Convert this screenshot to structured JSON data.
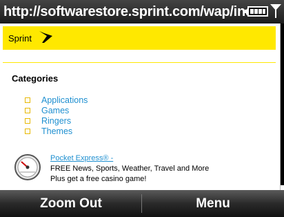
{
  "titlebar": {
    "url": "http://softwarestore.sprint.com/wap/ind",
    "battery_icon": "battery-icon",
    "signal_icon": "antenna-signal-icon"
  },
  "brand": {
    "name": "Sprint",
    "color": "#ffe800"
  },
  "categories": {
    "title": "Categories",
    "items": [
      {
        "label": "Applications"
      },
      {
        "label": "Games"
      },
      {
        "label": "Ringers"
      },
      {
        "label": "Themes"
      }
    ],
    "link_color": "#1e8fd0"
  },
  "promo": {
    "icon": "speedometer-icon",
    "link_text": "Pocket Express® -",
    "line2": "FREE News, Sports, Weather, Travel and More",
    "line3": "Plus get a free casino game!"
  },
  "softkeys": {
    "left": "Zoom Out",
    "right": "Menu"
  }
}
